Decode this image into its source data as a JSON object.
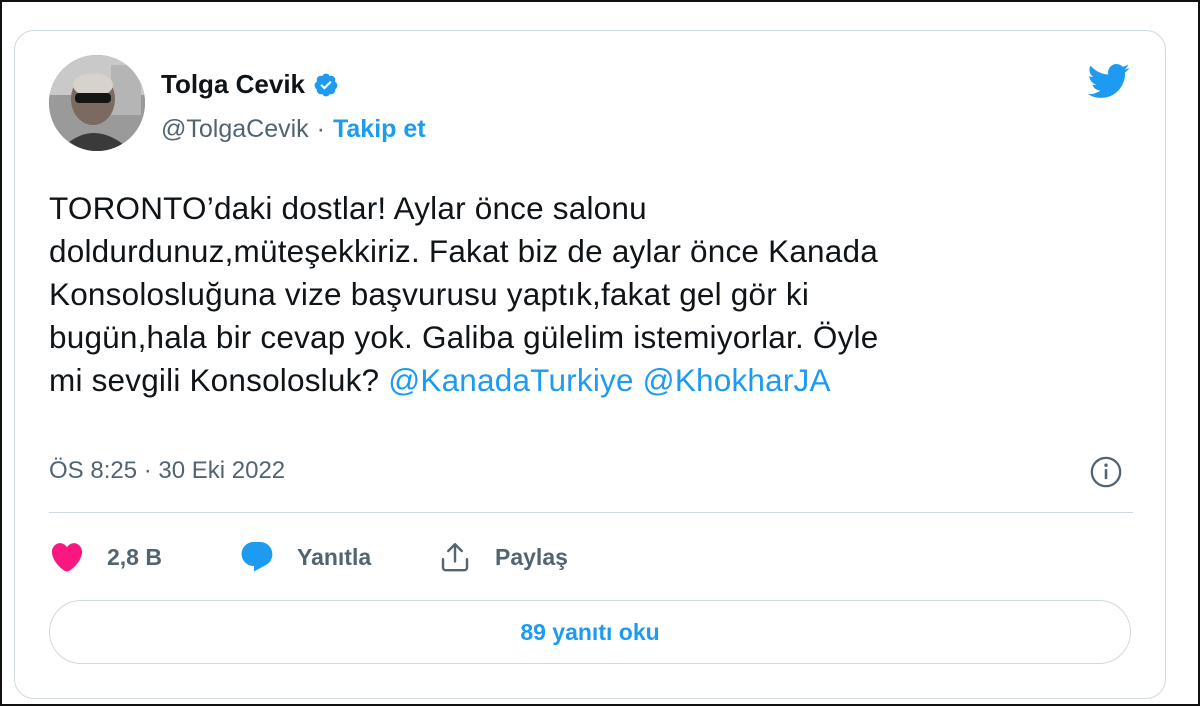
{
  "tweet": {
    "author": {
      "display_name": "Tolga Cevik",
      "handle": "@TolgaCevik",
      "separator": "·",
      "follow_label": "Takip et"
    },
    "text_lines": [
      "TORONTO’daki dostlar! Aylar önce salonu",
      "doldurdunuz,müteşekkiriz. Fakat biz de aylar önce Kanada",
      "Konsolosluğuna vize başvurusu yaptık,fakat gel gör ki",
      "bugün,hala bir cevap yok. Galiba gülelim istemiyorlar. Öyle"
    ],
    "last_line_text": "mi sevgili Konsolosluk?",
    "mentions": [
      "@KanadaTurkiye",
      "@KhokharJA"
    ],
    "timestamp": "ÖS 8:25 · 30 Eki 2022",
    "actions": {
      "like_count": "2,8 B",
      "reply_label": "Yanıtla",
      "share_label": "Paylaş"
    },
    "read_replies_label": "89 yanıtı oku"
  },
  "icons": {
    "verified": "verified-badge-icon",
    "brand": "twitter-bird-icon",
    "info": "info-icon",
    "like": "heart-icon",
    "reply": "speech-bubble-icon",
    "share": "share-icon"
  },
  "colors": {
    "accent": "#1d9bf0",
    "like": "#f91880",
    "text": "#0f1419",
    "secondary": "#536471",
    "border": "#cfd9de"
  }
}
